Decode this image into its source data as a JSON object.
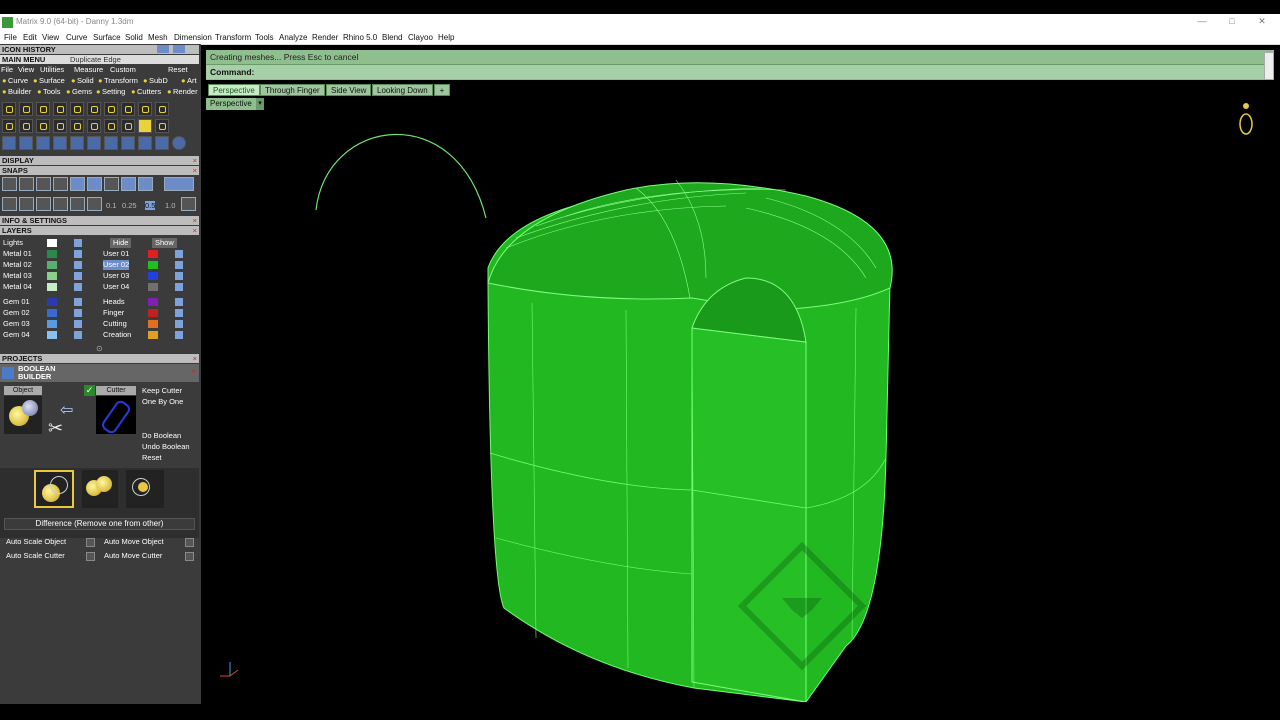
{
  "window": {
    "title": "Matrix 9.0 (64-bit) - Danny 1.3dm"
  },
  "menubar": [
    "File",
    "Edit",
    "View",
    "Curve",
    "Surface",
    "Solid",
    "Mesh",
    "Dimension",
    "Transform",
    "Tools",
    "Analyze",
    "Render",
    "Rhino 5.0",
    "Blend",
    "Clayoo",
    "Help"
  ],
  "left": {
    "icon_history": "ICON HISTORY",
    "main_menu": "MAIN MENU",
    "last_cmd": "Duplicate Edge",
    "submenu1": [
      "File",
      "View",
      "Utilities",
      "Measure",
      "Custom"
    ],
    "reset": "Reset",
    "submenu2": [
      "Curve",
      "Surface",
      "Solid",
      "Transform",
      "SubD",
      "Art"
    ],
    "submenu3": [
      "Builder",
      "Tools",
      "Gems",
      "Setting",
      "Cutters",
      "Render"
    ],
    "display": "DISPLAY",
    "snaps": "SNAPS",
    "snap_values": [
      "0.1",
      "0.25",
      "0.5",
      "1.0"
    ],
    "info": "INFO & SETTINGS",
    "layers": "LAYERS",
    "lights": "Lights",
    "hide": "Hide",
    "show": "Show",
    "layers_left": [
      "Metal 01",
      "Metal 02",
      "Metal 03",
      "Metal 04",
      "Gem 01",
      "Gem 02",
      "Gem 03",
      "Gem 04"
    ],
    "layers_right": [
      "User 01",
      "User 02",
      "User 03",
      "User 04",
      "Heads",
      "Finger",
      "Cutting",
      "Creation"
    ],
    "layer_colors_left": [
      "#2a8a4a",
      "#5ab070",
      "#8ad08a",
      "#c8ecc8",
      "#2a3ab0",
      "#3a6ad0",
      "#5a9ae0",
      "#8ac0f0"
    ],
    "layer_colors_right": [
      "#e02020",
      "#20c020",
      "#2040e0",
      "#707070",
      "#8020b0",
      "#c02020",
      "#e07020",
      "#e0a020"
    ],
    "projects": "PROJECTS",
    "boolean_builder": "BOOLEAN BUILDER",
    "object": "Object",
    "cutter": "Cutter",
    "keep_cutter": "Keep Cutter",
    "one_by_one": "One By One",
    "do_boolean": "Do Boolean",
    "undo_boolean": "Undo Boolean",
    "reset2": "Reset",
    "mode_label": "Difference (Remove one from other)",
    "auto_scale_object": "Auto Scale Object",
    "auto_move_object": "Auto Move Object",
    "auto_scale_cutter": "Auto Scale Cutter",
    "auto_move_cutter": "Auto Move Cutter"
  },
  "command": {
    "status": "Creating meshes... Press Esc to cancel",
    "prompt": "Command:"
  },
  "viewtabs": [
    "Perspective",
    "Through Finger",
    "Side View",
    "Looking Down"
  ],
  "viewport": {
    "label": "Perspective"
  },
  "colors": {
    "model": "#22c022",
    "wire": "#66ff66",
    "panel": "#3b3b3b",
    "cmd": "#8fbf8f"
  }
}
